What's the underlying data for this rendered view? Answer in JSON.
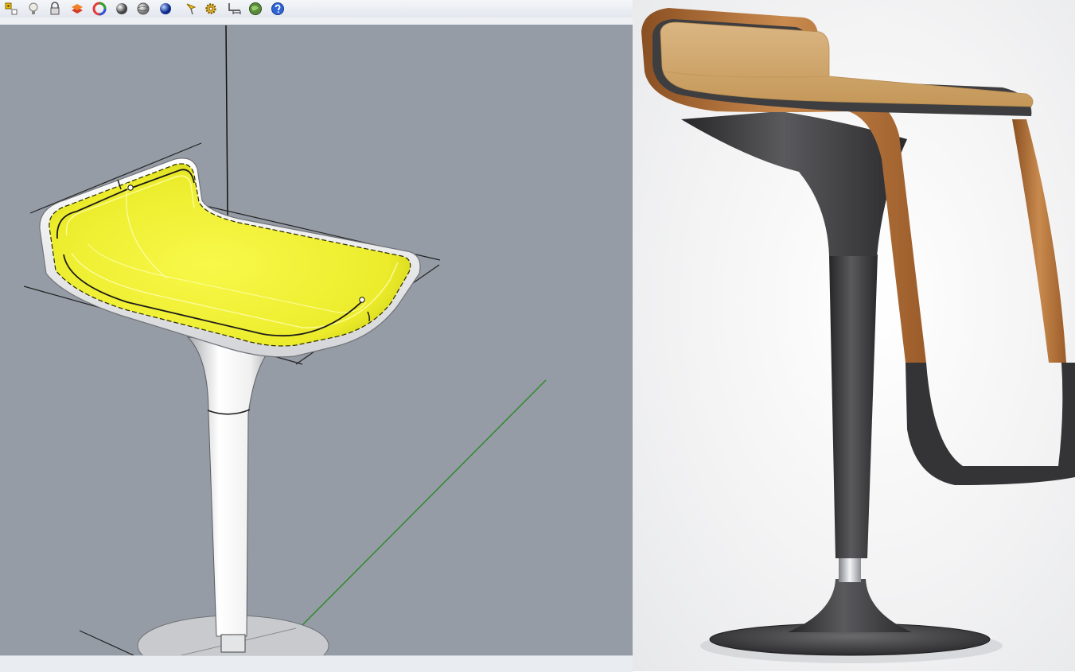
{
  "toolbar": {
    "buttons": [
      {
        "icon": "snap-icon"
      },
      {
        "icon": "light-bulb-icon"
      },
      {
        "icon": "lock-icon"
      },
      {
        "icon": "layer-icon"
      },
      {
        "icon": "color-wheel-icon"
      },
      {
        "icon": "shaded-sphere-icon"
      },
      {
        "icon": "ghosted-sphere-icon"
      },
      {
        "icon": "rendered-sphere-icon"
      },
      {
        "icon": "analysis-icon"
      },
      {
        "icon": "gear-icon"
      },
      {
        "icon": "dimension-icon"
      },
      {
        "icon": "globe-icon"
      },
      {
        "icon": "help-icon"
      }
    ]
  },
  "viewport": {
    "background_color": "#969ca5",
    "surface_color": "#f2f23a",
    "model": "white-bar-stool-wireframe"
  },
  "render_panel": {
    "background_color": "#f2f2f3",
    "seat_wood_color": "#d2a66a",
    "frame_color": "#3b3b3d"
  }
}
